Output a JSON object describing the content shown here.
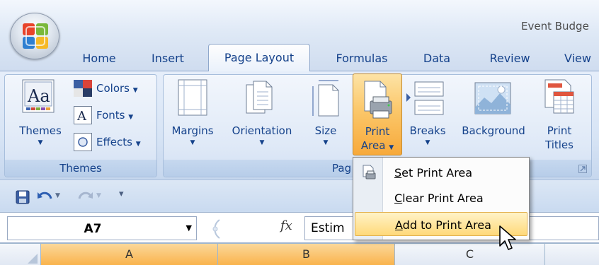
{
  "window": {
    "title": "Event Budge",
    "office_button": "office-logo"
  },
  "tabs": [
    {
      "label": "Home",
      "active": false
    },
    {
      "label": "Insert",
      "active": false
    },
    {
      "label": "Page Layout",
      "active": true
    },
    {
      "label": "Formulas",
      "active": false
    },
    {
      "label": "Data",
      "active": false
    },
    {
      "label": "Review",
      "active": false
    },
    {
      "label": "View",
      "active": false
    }
  ],
  "ribbon": {
    "themes_group": {
      "label": "Themes",
      "themes_button": "Themes",
      "colors_button": "Colors",
      "fonts_button": "Fonts",
      "effects_button": "Effects"
    },
    "page_setup_group": {
      "label": "Pag",
      "margins": "Margins",
      "orientation": "Orientation",
      "size": "Size",
      "print_area_line1": "Print",
      "print_area_line2": "Area",
      "breaks": "Breaks",
      "background": "Background",
      "print_titles_line1": "Print",
      "print_titles_line2": "Titles"
    }
  },
  "print_area_menu": {
    "items": [
      {
        "prefix": "",
        "accel": "S",
        "rest": "et Print Area",
        "icon": "set-print-area-icon",
        "highlighted": false
      },
      {
        "prefix": "",
        "accel": "C",
        "rest": "lear Print Area",
        "icon": "",
        "highlighted": false
      },
      {
        "prefix": "",
        "accel": "A",
        "rest": "dd to Print Area",
        "icon": "",
        "highlighted": true
      }
    ]
  },
  "formula_bar": {
    "name_box": "A7",
    "fx_label": "fx",
    "value": "Estim"
  },
  "columns": [
    {
      "label": "A",
      "selected": true
    },
    {
      "label": "B",
      "selected": true
    },
    {
      "label": "C",
      "selected": false
    }
  ],
  "colors": {
    "ribbon_text": "#15428b",
    "highlight": "#fbc76a",
    "selected_column": "#f9b24a"
  }
}
